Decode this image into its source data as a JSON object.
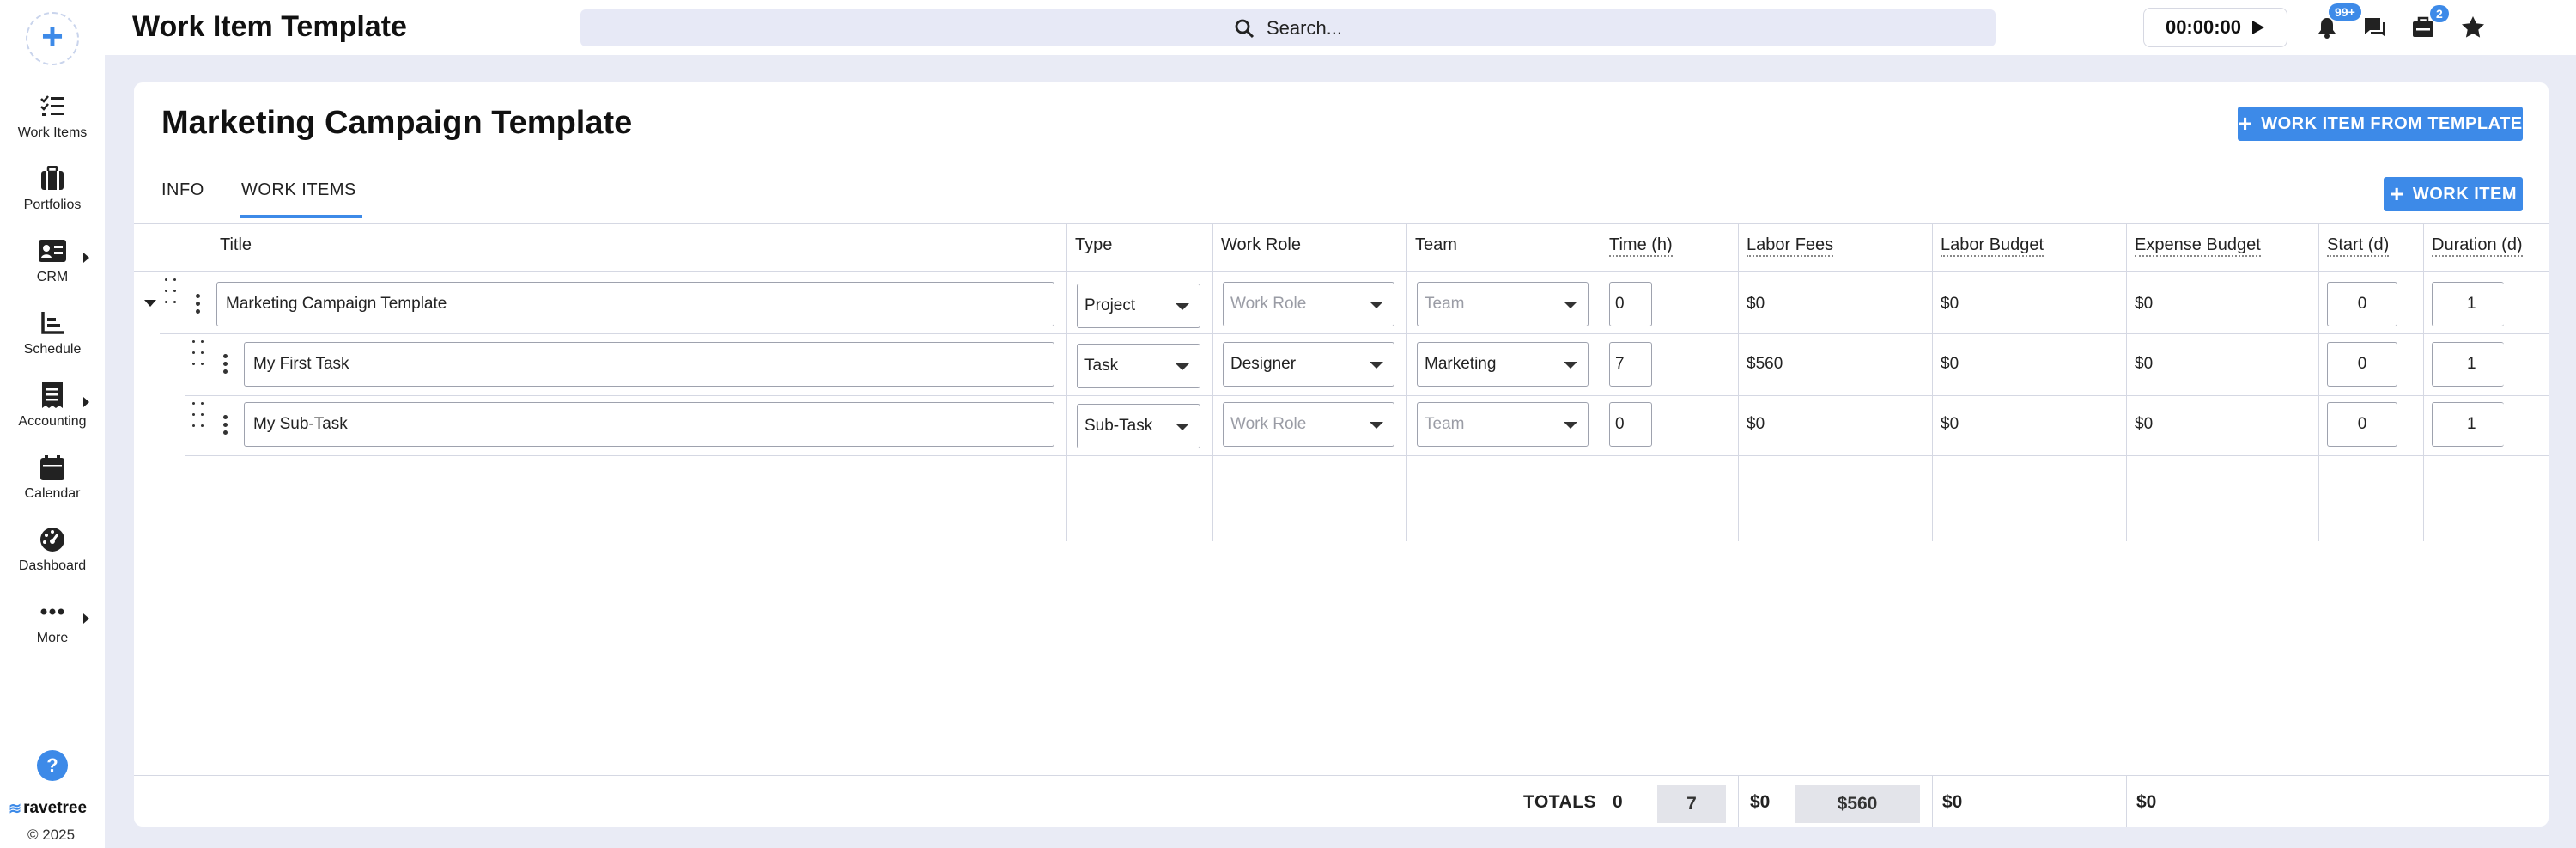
{
  "app": {
    "title": "Work Item Template",
    "brand": "ravetree",
    "copyright": "© 2025",
    "help": "?"
  },
  "sidebar": {
    "items": [
      {
        "label": "Work Items",
        "icon": "checklist-icon",
        "has_submenu": false
      },
      {
        "label": "Portfolios",
        "icon": "briefcase-icon",
        "has_submenu": false
      },
      {
        "label": "CRM",
        "icon": "contact-card-icon",
        "has_submenu": true
      },
      {
        "label": "Schedule",
        "icon": "chart-icon",
        "has_submenu": false
      },
      {
        "label": "Accounting",
        "icon": "receipt-icon",
        "has_submenu": true
      },
      {
        "label": "Calendar",
        "icon": "calendar-icon",
        "has_submenu": false
      },
      {
        "label": "Dashboard",
        "icon": "gauge-icon",
        "has_submenu": false
      },
      {
        "label": "More",
        "icon": "more-icon",
        "has_submenu": true
      }
    ]
  },
  "topbar": {
    "search_placeholder": "Search...",
    "timer": "00:00:00",
    "notifications_badge": "99+",
    "inbox_badge": "2"
  },
  "card": {
    "title": "Marketing Campaign Template",
    "template_button": "WORK ITEM FROM TEMPLATE",
    "add_button": "WORK ITEM",
    "tabs": [
      {
        "label": "INFO",
        "active": false
      },
      {
        "label": "WORK ITEMS",
        "active": true
      }
    ]
  },
  "table": {
    "columns": [
      "Title",
      "Type",
      "Work Role",
      "Team",
      "Time (h)",
      "Labor Fees",
      "Labor Budget",
      "Expense Budget",
      "Start (d)",
      "Duration (d)"
    ],
    "rows": [
      {
        "title": "Marketing Campaign Template",
        "type": "Project",
        "work_role": "Work Role",
        "team": "Team",
        "time": "0",
        "labor_fees": "$0",
        "labor_budget": "$0",
        "expense_budget": "$0",
        "start": "0",
        "duration": "1"
      },
      {
        "title": "My First Task",
        "type": "Task",
        "work_role": "Designer",
        "team": "Marketing",
        "time": "7",
        "labor_fees": "$560",
        "labor_budget": "$0",
        "expense_budget": "$0",
        "start": "0",
        "duration": "1"
      },
      {
        "title": "My Sub-Task",
        "type": "Sub-Task",
        "work_role": "Work Role",
        "team": "Team",
        "time": "0",
        "labor_fees": "$0",
        "labor_budget": "$0",
        "expense_budget": "$0",
        "start": "0",
        "duration": "1"
      }
    ],
    "totals": {
      "label": "TOTALS",
      "time_a": "0",
      "time_b": "7",
      "fees_a": "$0",
      "fees_b": "$560",
      "labor_budget": "$0",
      "expense_budget": "$0"
    }
  },
  "colors": {
    "accent": "#3d8ae8",
    "background": "#e9ebf5",
    "border": "#d5d8e3"
  }
}
